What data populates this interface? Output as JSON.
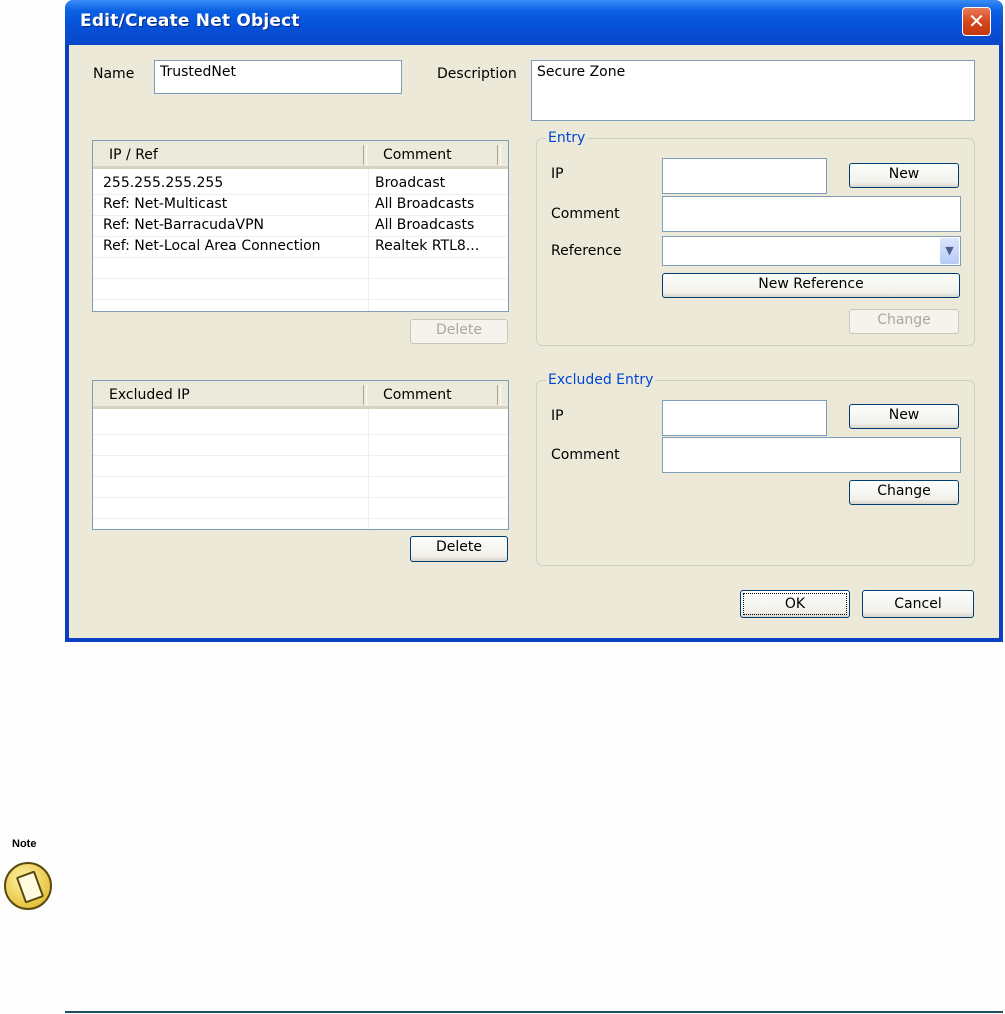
{
  "window": {
    "title": "Edit/Create Net Object",
    "close_glyph": "✕"
  },
  "name_field": {
    "label": "Name",
    "value": "TrustedNet"
  },
  "description_field": {
    "label": "Description",
    "value": "Secure Zone"
  },
  "ip_list": {
    "columns": [
      "IP / Ref",
      "Comment"
    ],
    "rows": [
      {
        "ip": "255.255.255.255",
        "comment": "Broadcast"
      },
      {
        "ip": "Ref: Net-Multicast",
        "comment": "All Broadcasts"
      },
      {
        "ip": "Ref: Net-BarracudaVPN",
        "comment": "All Broadcasts"
      },
      {
        "ip": "Ref: Net-Local Area Connection",
        "comment": "Realtek RTL8..."
      }
    ],
    "delete_label": "Delete"
  },
  "excluded_list": {
    "columns": [
      "Excluded IP",
      "Comment"
    ],
    "delete_label": "Delete"
  },
  "entry_group": {
    "legend": "Entry",
    "ip_label": "IP",
    "ip_value": "",
    "comment_label": "Comment",
    "comment_value": "",
    "reference_label": "Reference",
    "reference_value": "",
    "new_label": "New",
    "new_reference_label": "New Reference",
    "change_label": "Change"
  },
  "excluded_group": {
    "legend": "Excluded Entry",
    "ip_label": "IP",
    "ip_value": "",
    "comment_label": "Comment",
    "comment_value": "",
    "new_label": "New",
    "change_label": "Change"
  },
  "footer": {
    "ok_label": "OK",
    "cancel_label": "Cancel"
  },
  "note": {
    "label": "Note",
    "icon": "note-icon"
  },
  "colors": {
    "title_bar": "#0a5fe2",
    "dialog_bg": "#ece9d8",
    "legend_text": "#0046d5",
    "close_button": "#d6461c"
  }
}
